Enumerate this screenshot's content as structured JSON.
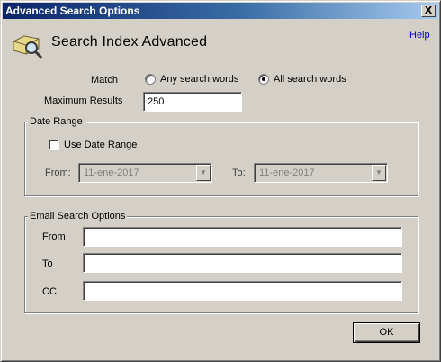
{
  "window": {
    "title": "Advanced Search Options",
    "close_glyph": "X"
  },
  "header": {
    "title": "Search Index Advanced",
    "icon": "magnifier-folder-icon",
    "help_link": "Help"
  },
  "match": {
    "label": "Match",
    "options": [
      {
        "label": "Any search words",
        "selected": false
      },
      {
        "label": "All search words",
        "selected": true
      }
    ]
  },
  "max_results": {
    "label": "Maximum Results",
    "value": "250"
  },
  "date_range": {
    "group_title": "Date Range",
    "use_date_range_label": "Use Date Range",
    "use_date_range_checked": false,
    "from_label": "From:",
    "from_value": "11-ene-2017",
    "to_label": "To:",
    "to_value": "11-ene-2017"
  },
  "email_options": {
    "group_title": "Email Search Options",
    "from_label": "From",
    "from_value": "",
    "to_label": "To",
    "to_value": "",
    "cc_label": "CC",
    "cc_value": ""
  },
  "buttons": {
    "ok_label": "OK"
  },
  "colors": {
    "dialog_bg": "#d4d0c8",
    "titlebar_start": "#0a246a",
    "titlebar_end": "#a6caf0",
    "link": "#0000cc"
  }
}
